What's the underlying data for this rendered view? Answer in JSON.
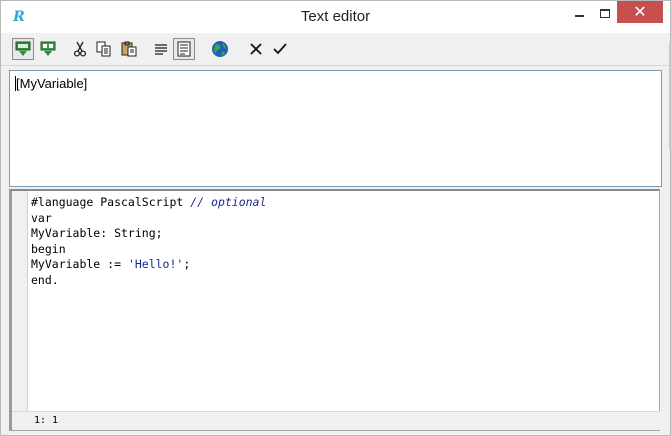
{
  "window": {
    "title": "Text editor",
    "app_icon": "R"
  },
  "titlebar_buttons": {
    "minimize": "minimize-icon",
    "maximize": "maximize-icon",
    "close": "close-icon",
    "close_glyph": "✕"
  },
  "toolbar": {
    "items": [
      {
        "name": "insert-expression-icon"
      },
      {
        "name": "insert-aggregate-icon"
      },
      {
        "name": "cut-icon"
      },
      {
        "name": "copy-icon"
      },
      {
        "name": "paste-icon"
      },
      {
        "name": "word-wrap-icon"
      },
      {
        "name": "script-mode-icon"
      },
      {
        "name": "globe-icon"
      },
      {
        "name": "cancel-icon"
      },
      {
        "name": "ok-icon"
      }
    ]
  },
  "expression": {
    "value": "[MyVariable]"
  },
  "code": {
    "lines": [
      {
        "text": "#language PascalScript ",
        "comment": "// optional"
      },
      {
        "text": "var"
      },
      {
        "text": "MyVariable: String;"
      },
      {
        "text": "begin"
      },
      {
        "text": "MyVariable := ",
        "string": "'Hello!'",
        "tail": ";"
      },
      {
        "text": "end."
      }
    ]
  },
  "status": {
    "position": "1: 1"
  },
  "colors": {
    "close_button": "#c7504f",
    "accent_border": "#7a9cbc",
    "comment": "#1b2a8a"
  }
}
